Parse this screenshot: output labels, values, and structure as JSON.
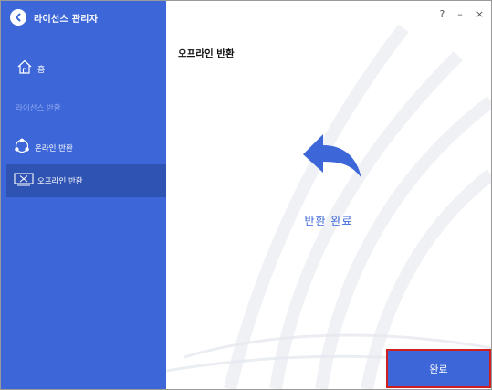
{
  "app": {
    "title": "라이선스 관리자"
  },
  "sidebar": {
    "home_label": "홈",
    "section_label": "라이선스 반환",
    "items": [
      {
        "label": "온라인 반환",
        "icon": "online-icon"
      },
      {
        "label": "오프라인 반환",
        "icon": "offline-icon",
        "selected": true
      }
    ]
  },
  "window_controls": {
    "help": "?",
    "minimize": "–",
    "close": "×"
  },
  "main": {
    "page_title": "오프라인 반환",
    "status_text": "반환 완료",
    "done_label": "완료"
  },
  "colors": {
    "accent": "#3d67d8",
    "sidebar_selected": "#2f53b3",
    "highlight_border": "#d01f1f"
  }
}
